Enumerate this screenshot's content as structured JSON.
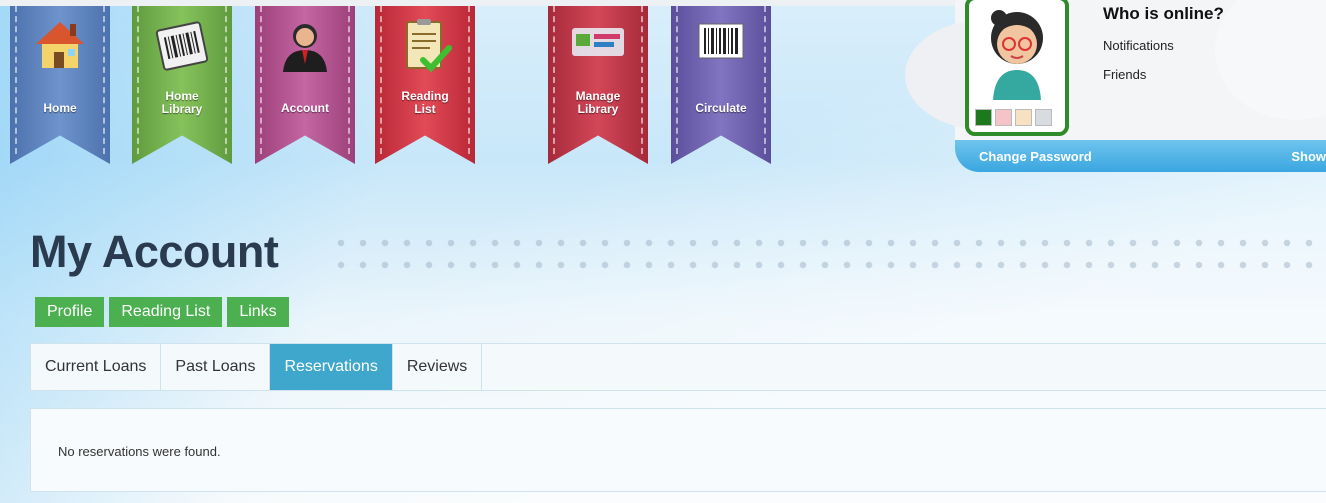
{
  "nav": {
    "items": [
      {
        "label": "Home"
      },
      {
        "label": "Home\nLibrary"
      },
      {
        "label": "Account"
      },
      {
        "label": "Reading\nList"
      },
      {
        "label": "Manage\nLibrary"
      },
      {
        "label": "Circulate"
      }
    ]
  },
  "user_panel": {
    "title": "Who is online?",
    "links": [
      "Notifications",
      "Friends"
    ],
    "change_password": "Change Password",
    "show": "Show",
    "swatch_colors": [
      "#1c7a1c",
      "#f6c3c9",
      "#f7e1c2",
      "#d8dbe0"
    ]
  },
  "page": {
    "title": "My Account"
  },
  "section_tabs": [
    "Profile",
    "Reading List",
    "Links"
  ],
  "tabs": [
    "Current Loans",
    "Past Loans",
    "Reservations",
    "Reviews"
  ],
  "active_tab": "Reservations",
  "content": {
    "message": "No reservations were found."
  }
}
